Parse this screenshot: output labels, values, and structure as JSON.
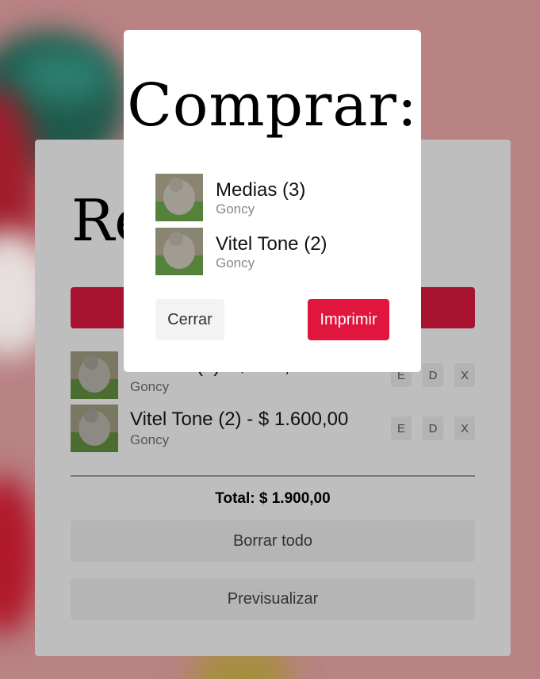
{
  "modal": {
    "title": "Comprar:",
    "items": [
      {
        "name": "Medias (3)",
        "seller": "Goncy"
      },
      {
        "name": "Vitel Tone (2)",
        "seller": "Goncy"
      }
    ],
    "close_label": "Cerrar",
    "print_label": "Imprimir"
  },
  "cart": {
    "title_visible": "Re",
    "items": [
      {
        "name": "Medias (3) - $ 300,00",
        "seller": "Goncy",
        "edit": "E",
        "duplicate": "D",
        "remove": "X"
      },
      {
        "name": "Vitel Tone (2) - $ 1.600,00",
        "seller": "Goncy",
        "edit": "E",
        "duplicate": "D",
        "remove": "X"
      }
    ],
    "total": "Total: $ 1.900,00",
    "clear_label": "Borrar todo",
    "preview_label": "Previsualizar"
  },
  "colors": {
    "accent": "#e0163f",
    "background": "#b98283"
  }
}
